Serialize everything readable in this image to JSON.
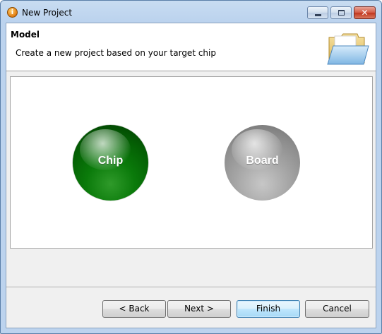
{
  "window": {
    "title": "New Project",
    "app_icon_glyph": "i",
    "controls": {
      "minimize": "",
      "maximize": "",
      "close": "✕"
    }
  },
  "header": {
    "title": "Model",
    "description": "Create a new project based on your target chip",
    "icon": "folder-open-icon"
  },
  "options": [
    {
      "label": "Chip",
      "color": "#0a7a0a"
    },
    {
      "label": "Board",
      "color": "#a4a4a4"
    }
  ],
  "buttons": {
    "back": "< Back",
    "next": "Next >",
    "finish": "Finish",
    "cancel": "Cancel"
  },
  "colors": {
    "accent": "#3c7fb1",
    "titlebar": "#bcd3ee"
  }
}
